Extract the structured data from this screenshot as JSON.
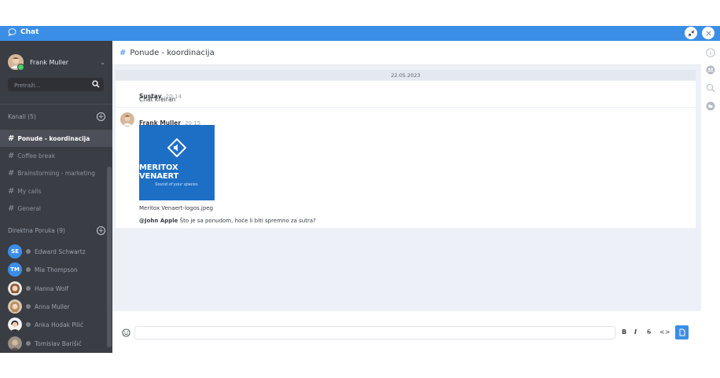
{
  "app": {
    "title": "Chat"
  },
  "sidebar": {
    "user": {
      "name": "Frank Muller"
    },
    "search_placeholder": "Pretraži...",
    "channels_title": "Kanali (5)",
    "channels": [
      {
        "label": "Ponude - koordinacija",
        "active": true
      },
      {
        "label": "Coffee break",
        "active": false
      },
      {
        "label": "Brainstorming - marketing",
        "active": false
      },
      {
        "label": "My calls",
        "active": false
      },
      {
        "label": "General",
        "active": false
      }
    ],
    "direct_title": "Direktna Poruka (9)",
    "direct": [
      {
        "initials": "SE",
        "name": "Edward Schwartz"
      },
      {
        "initials": "TM",
        "name": "Mia Thompson"
      },
      {
        "initials": "",
        "name": "Hanna Wolf"
      },
      {
        "initials": "",
        "name": "Anna Muller"
      },
      {
        "initials": "",
        "name": "Anka Hodak Pilić"
      },
      {
        "initials": "",
        "name": "Tomislav Barišić"
      }
    ]
  },
  "channel": {
    "name": "Ponude - koordinacija",
    "date": "22.05.2023",
    "messages": [
      {
        "sender": "Sustav",
        "time": "20:14",
        "text": "Chat kreiran"
      },
      {
        "sender": "Frank Muller",
        "time": "20:15",
        "image": {
          "title": "MERITOX VENAERT",
          "subtitle": "Sound of your spaces.",
          "filename": "Meritox Venaert-logos.jpeg"
        },
        "mention": "@John Apple",
        "text": "Što je sa ponudom, hoće li biti spremno za sutra?"
      }
    ]
  },
  "composer": {
    "placeholder": "",
    "format": {
      "bold": "B",
      "italic": "I",
      "strike": "S",
      "code": "<>"
    }
  },
  "colors": {
    "accent": "#3b8ee6",
    "sidebar": "#3a3d44",
    "online": "#45d16a"
  }
}
